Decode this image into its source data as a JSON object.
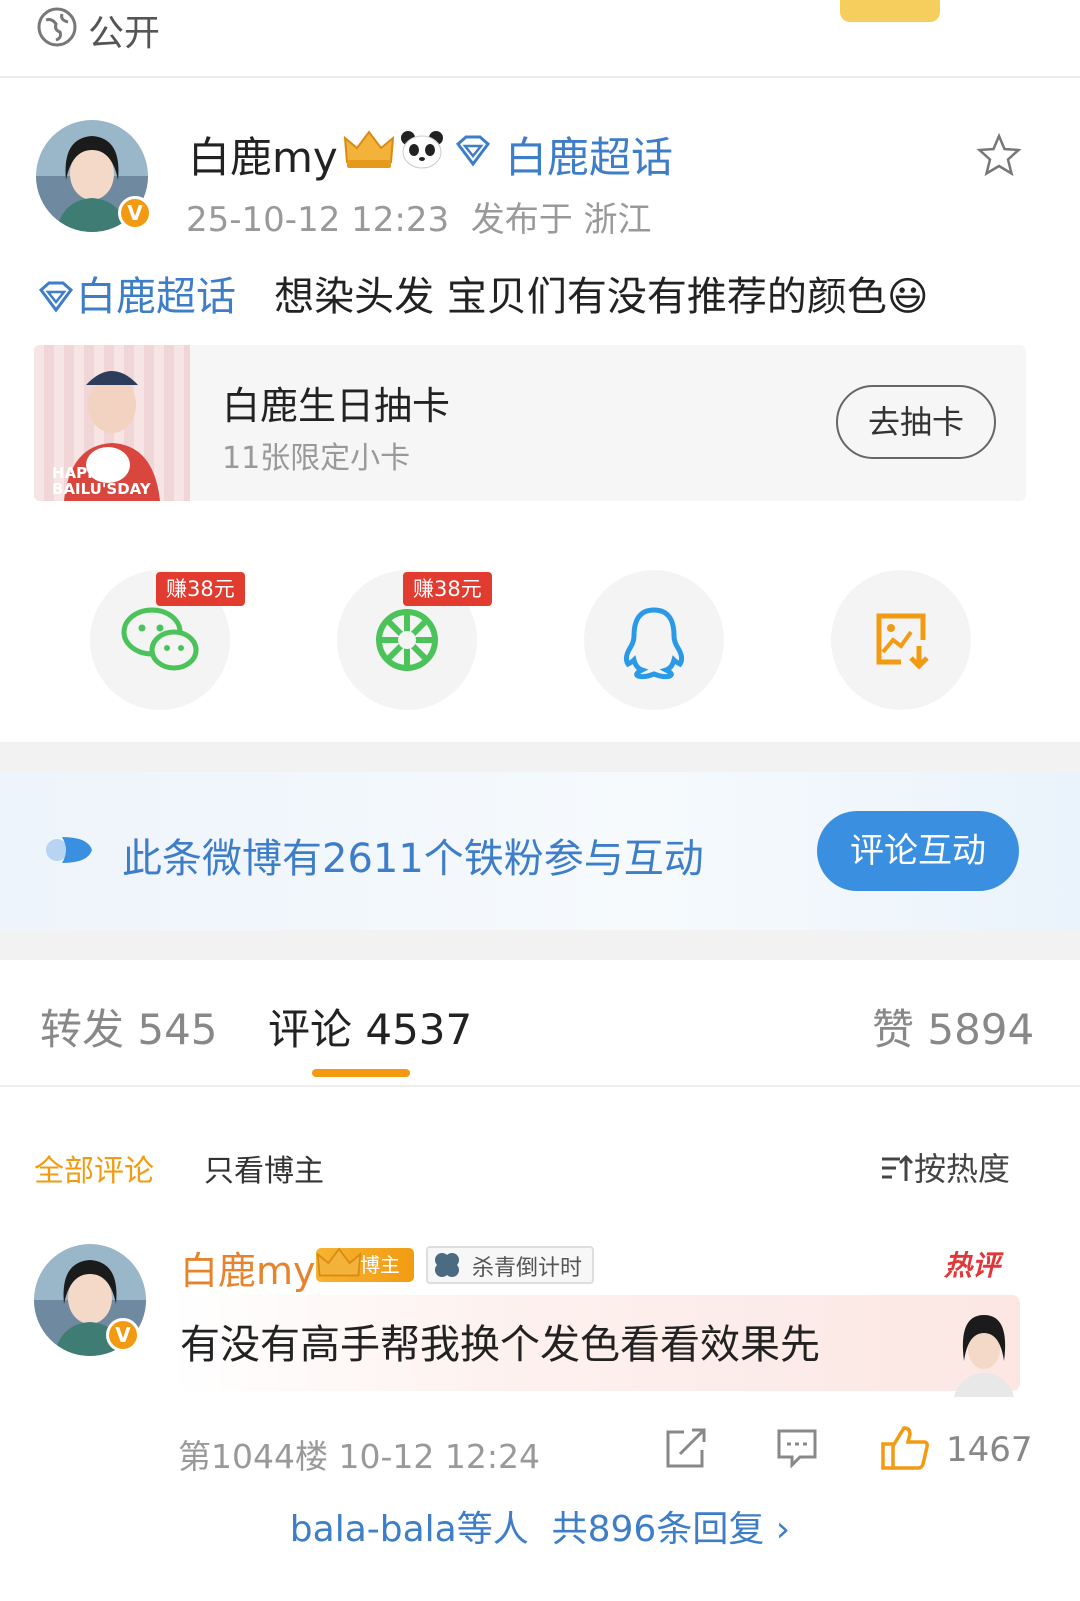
{
  "visibility": {
    "label": "公开",
    "icon": "globe-icon"
  },
  "post": {
    "author": "白鹿my",
    "topic": "白鹿超话",
    "meta": "25-10-12 12:23  发布于 浙江",
    "text_tag": "白鹿超话",
    "text": "想染头发 宝贝们有没有推荐的颜色",
    "emoji": "😃"
  },
  "card": {
    "title": "白鹿生日抽卡",
    "subtitle": "11张限定小卡",
    "button": "去抽卡",
    "thumb_text": "HAPPY BAILU'SDAY"
  },
  "share": {
    "earn_label": "赚38元",
    "items": [
      {
        "icon": "wechat-icon",
        "color": "#4cc25a"
      },
      {
        "icon": "moments-icon",
        "color": "#4cc25a"
      },
      {
        "icon": "qq-icon",
        "color": "#2a9ae6"
      },
      {
        "icon": "save-image-icon",
        "color": "#f29b12"
      }
    ]
  },
  "fans_banner": {
    "text": "此条微博有2611个铁粉参与互动",
    "button": "评论互动"
  },
  "tabs": {
    "repost": "转发 545",
    "comment": "评论 4537",
    "like": "赞 5894"
  },
  "filters": {
    "all": "全部评论",
    "blogger_only": "只看博主",
    "sort": "按热度"
  },
  "comment": {
    "author": "白鹿my",
    "blogger_badge": "博主",
    "tag_badge": "杀青倒计时",
    "hot_label": "热评",
    "text": "有没有高手帮我换个发色看看效果先",
    "meta": "第1044楼 10-12 12:24",
    "likes": "1467",
    "replies": "bala-bala等人  共896条回复 ›"
  },
  "colors": {
    "accent": "#f29b12",
    "link": "#3e7dc7",
    "hot": "#e0383a",
    "fans_button": "#3b8fe0"
  }
}
